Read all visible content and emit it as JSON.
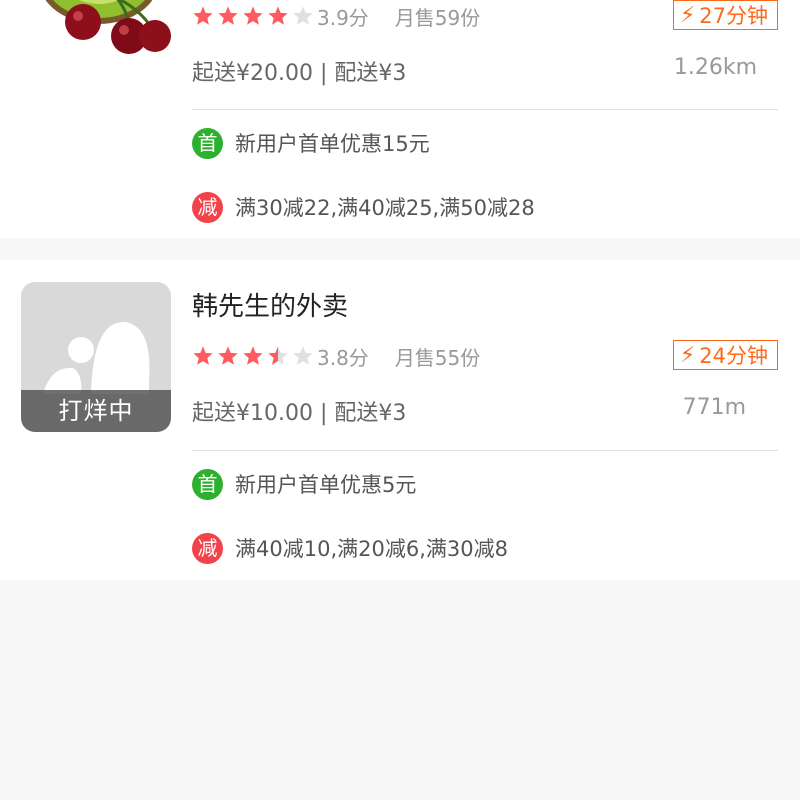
{
  "colors": {
    "star_filled": "#ff5a5f",
    "star_empty": "#e0e0e0",
    "time_accent": "#ff6a1a",
    "first_order_icon": "#2db02d",
    "discount_icon": "#f2434b"
  },
  "shops": [
    {
      "name": "",
      "thumbnail_icon": "fruit-kiwi-cherry-icon",
      "rating": 3.9,
      "score_text": "3.9分",
      "monthly_sales": "月售59份",
      "delivery_time": "27分钟",
      "delivery_info": "起送¥20.00 | 配送¥3",
      "distance": "1.26km",
      "promotions": [
        {
          "icon_label": "首",
          "icon": "first-order-icon",
          "text": "新用户首单优惠15元"
        },
        {
          "icon_label": "减",
          "icon": "discount-icon",
          "text": "满30减22,满40减25,满50减28"
        }
      ]
    },
    {
      "name": "韩先生的外卖",
      "thumbnail_icon": "placeholder-image-icon",
      "status_banner": "打烊中",
      "rating": 3.8,
      "score_text": "3.8分",
      "monthly_sales": "月售55份",
      "delivery_time": "24分钟",
      "delivery_info": "起送¥10.00 | 配送¥3",
      "distance": "771m",
      "promotions": [
        {
          "icon_label": "首",
          "icon": "first-order-icon",
          "text": "新用户首单优惠5元"
        },
        {
          "icon_label": "减",
          "icon": "discount-icon",
          "text": "满40减10,满20减6,满30减8"
        }
      ]
    }
  ]
}
